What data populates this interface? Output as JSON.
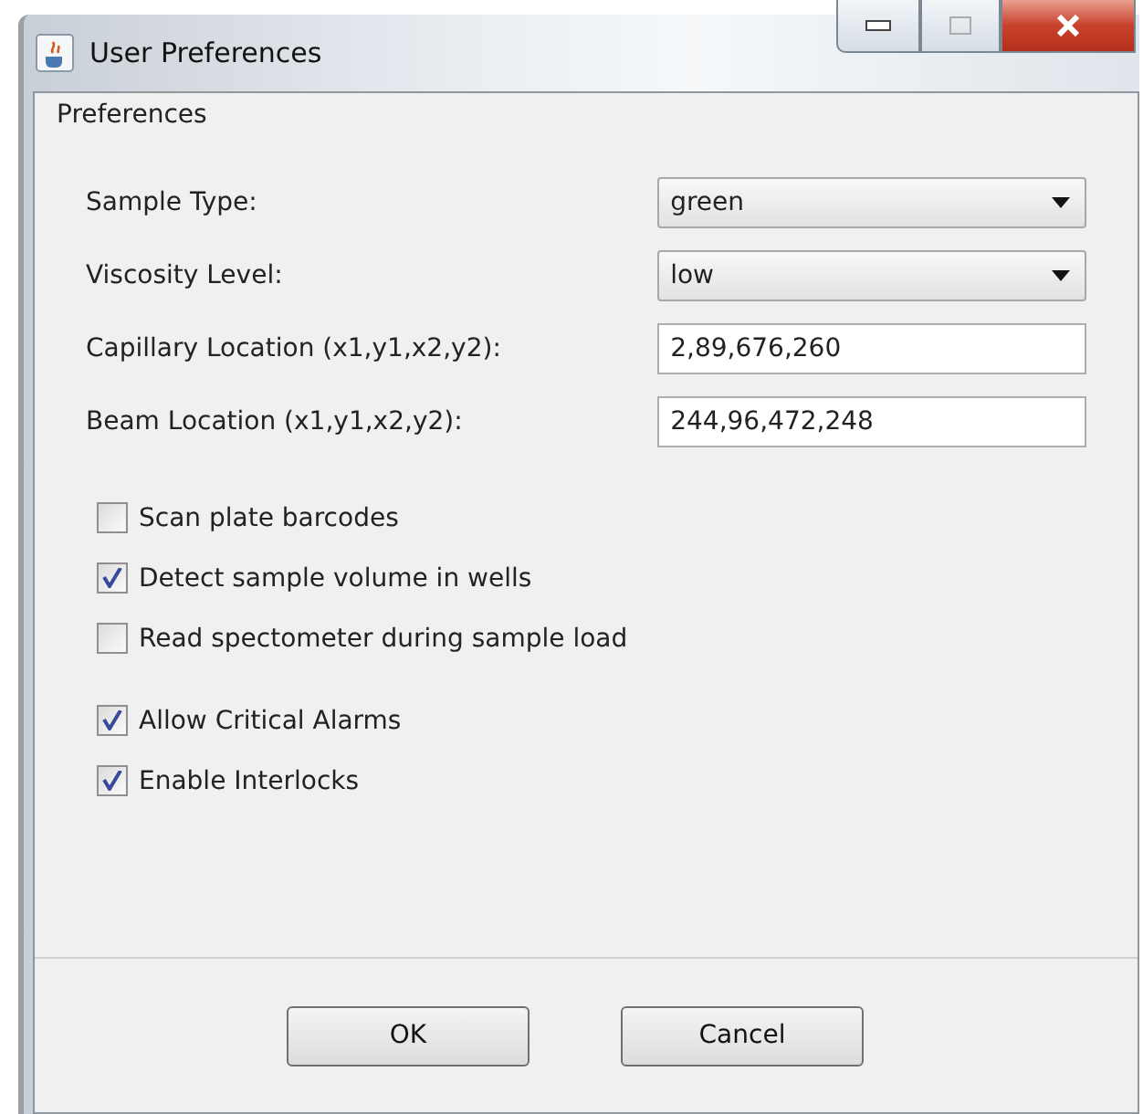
{
  "window": {
    "title": "User Preferences"
  },
  "panel": {
    "title": "Preferences"
  },
  "fields": [
    {
      "kind": "dropdown",
      "label": "Sample Type:",
      "value": "green"
    },
    {
      "kind": "dropdown",
      "label": "Viscosity Level:",
      "value": "low"
    },
    {
      "kind": "text",
      "label": "Capillary Location  (x1,y1,x2,y2):",
      "value": "2,89,676,260"
    },
    {
      "kind": "text",
      "label": "Beam Location (x1,y1,x2,y2):",
      "value": "244,96,472,248"
    }
  ],
  "checkbox_groups": [
    {
      "items": [
        {
          "label": "Scan plate barcodes",
          "checked": false
        },
        {
          "label": "Detect sample volume in wells",
          "checked": true
        },
        {
          "label": "Read spectometer during sample load",
          "checked": false
        }
      ]
    },
    {
      "items": [
        {
          "label": "Allow Critical Alarms",
          "checked": true
        },
        {
          "label": "Enable Interlocks",
          "checked": true
        }
      ]
    }
  ],
  "buttons": [
    "OK",
    "Cancel"
  ]
}
